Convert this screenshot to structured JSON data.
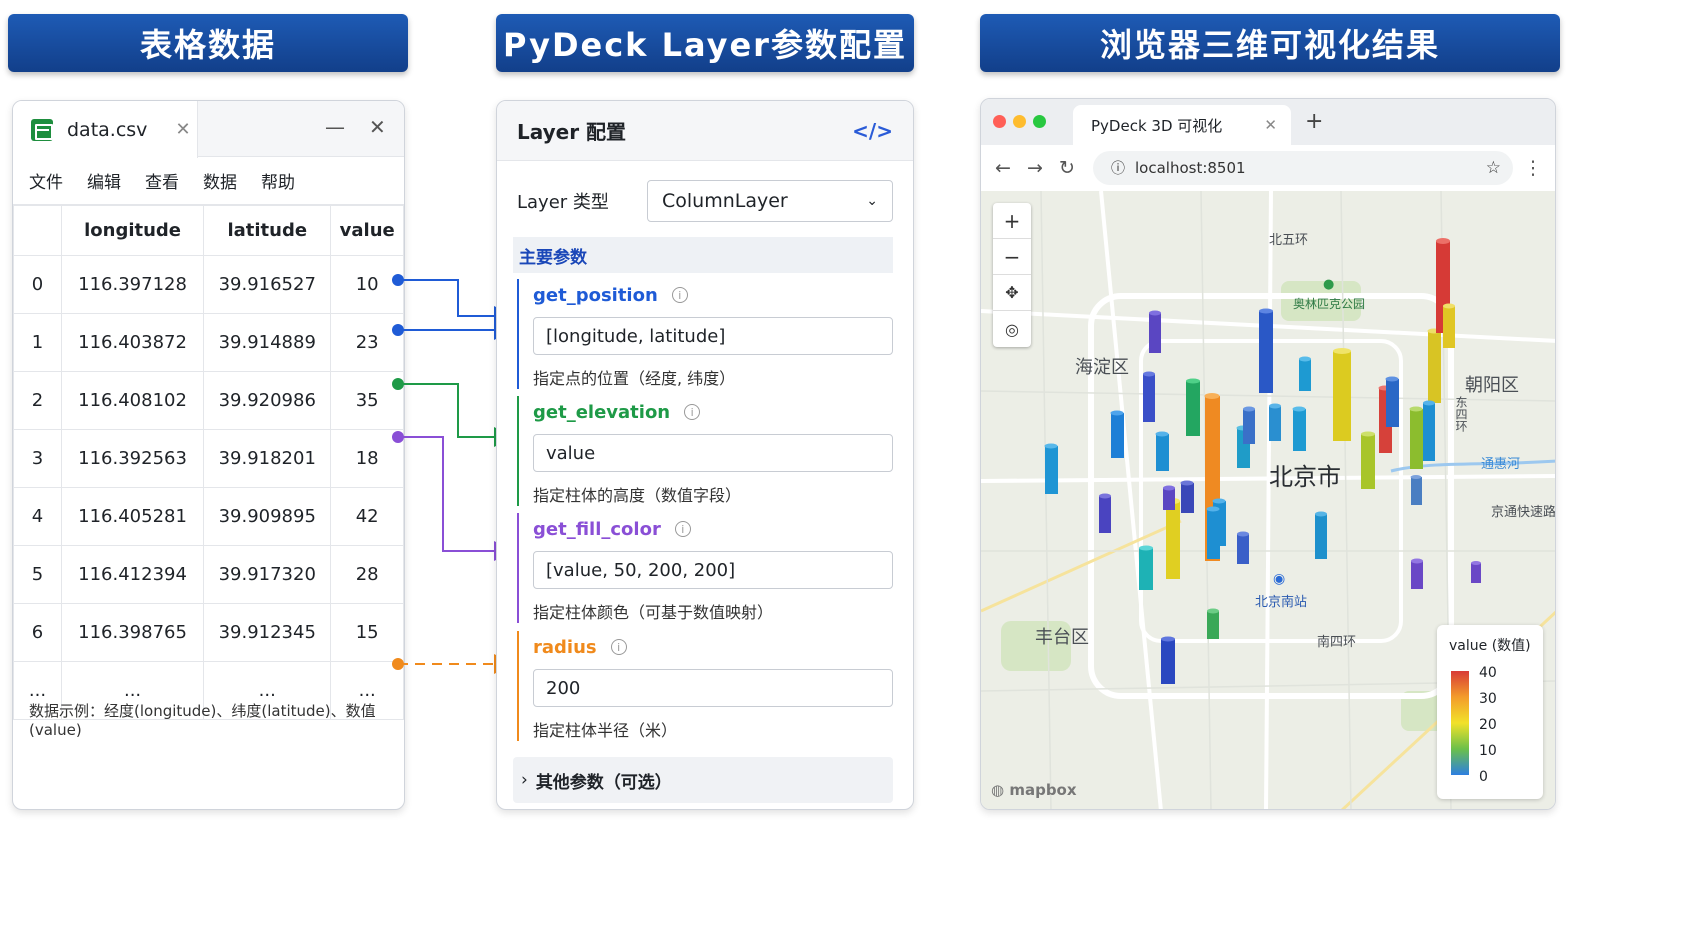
{
  "banners": {
    "data": "表格数据",
    "config": "PyDeck Layer参数配置",
    "result": "浏览器三维可视化结果"
  },
  "sheet": {
    "tab_title": "data.csv",
    "menu": [
      "文件",
      "编辑",
      "查看",
      "数据",
      "帮助"
    ],
    "columns": [
      "longitude",
      "latitude",
      "value"
    ],
    "rows": [
      [
        "0",
        "116.397128",
        "39.916527",
        "10"
      ],
      [
        "1",
        "116.403872",
        "39.914889",
        "23"
      ],
      [
        "2",
        "116.408102",
        "39.920986",
        "35"
      ],
      [
        "3",
        "116.392563",
        "39.918201",
        "18"
      ],
      [
        "4",
        "116.405281",
        "39.909895",
        "42"
      ],
      [
        "5",
        "116.412394",
        "39.917320",
        "28"
      ],
      [
        "6",
        "116.398765",
        "39.912345",
        "15"
      ],
      [
        "...",
        "...",
        "...",
        "..."
      ]
    ],
    "note": "数据示例：经度(longitude)、纬度(latitude)、数值(value)"
  },
  "config": {
    "title": "Layer 配置",
    "type_label": "Layer 类型",
    "type_value": "ColumnLayer",
    "section": "主要参数",
    "params": [
      {
        "name": "get_position",
        "value": "[longitude, latitude]",
        "desc": "指定点的位置（经度, 纬度）",
        "color": "#1f5bd6"
      },
      {
        "name": "get_elevation",
        "value": "value",
        "desc": "指定柱体的高度（数值字段）",
        "color": "#1e9a47"
      },
      {
        "name": "get_fill_color",
        "value": "[value, 50, 200, 200]",
        "desc": "指定柱体颜色（可基于数值映射）",
        "color": "#8a4fd6"
      },
      {
        "name": "radius",
        "value": "200",
        "desc": "指定柱体半径（米）",
        "color": "#f08a1c"
      }
    ],
    "others": "其他参数（可选）"
  },
  "browser": {
    "tab_title": "PyDeck 3D 可视化",
    "url": "localhost:8501",
    "map_labels": {
      "bei5": "北五环",
      "olympic": "奥林匹克公园",
      "haidian": "海淀区",
      "chaoyang": "朝阳区",
      "dongsi": "东四环",
      "tonghui": "通惠河",
      "beijing": "北京市",
      "jingtong": "京通快速路",
      "south_station": "北京南站",
      "fengtai": "丰台区",
      "nansi": "南四环"
    },
    "legend_title": "value (数值)",
    "legend_ticks": [
      "40",
      "30",
      "20",
      "10",
      "0"
    ],
    "attribution": "mapbox"
  }
}
